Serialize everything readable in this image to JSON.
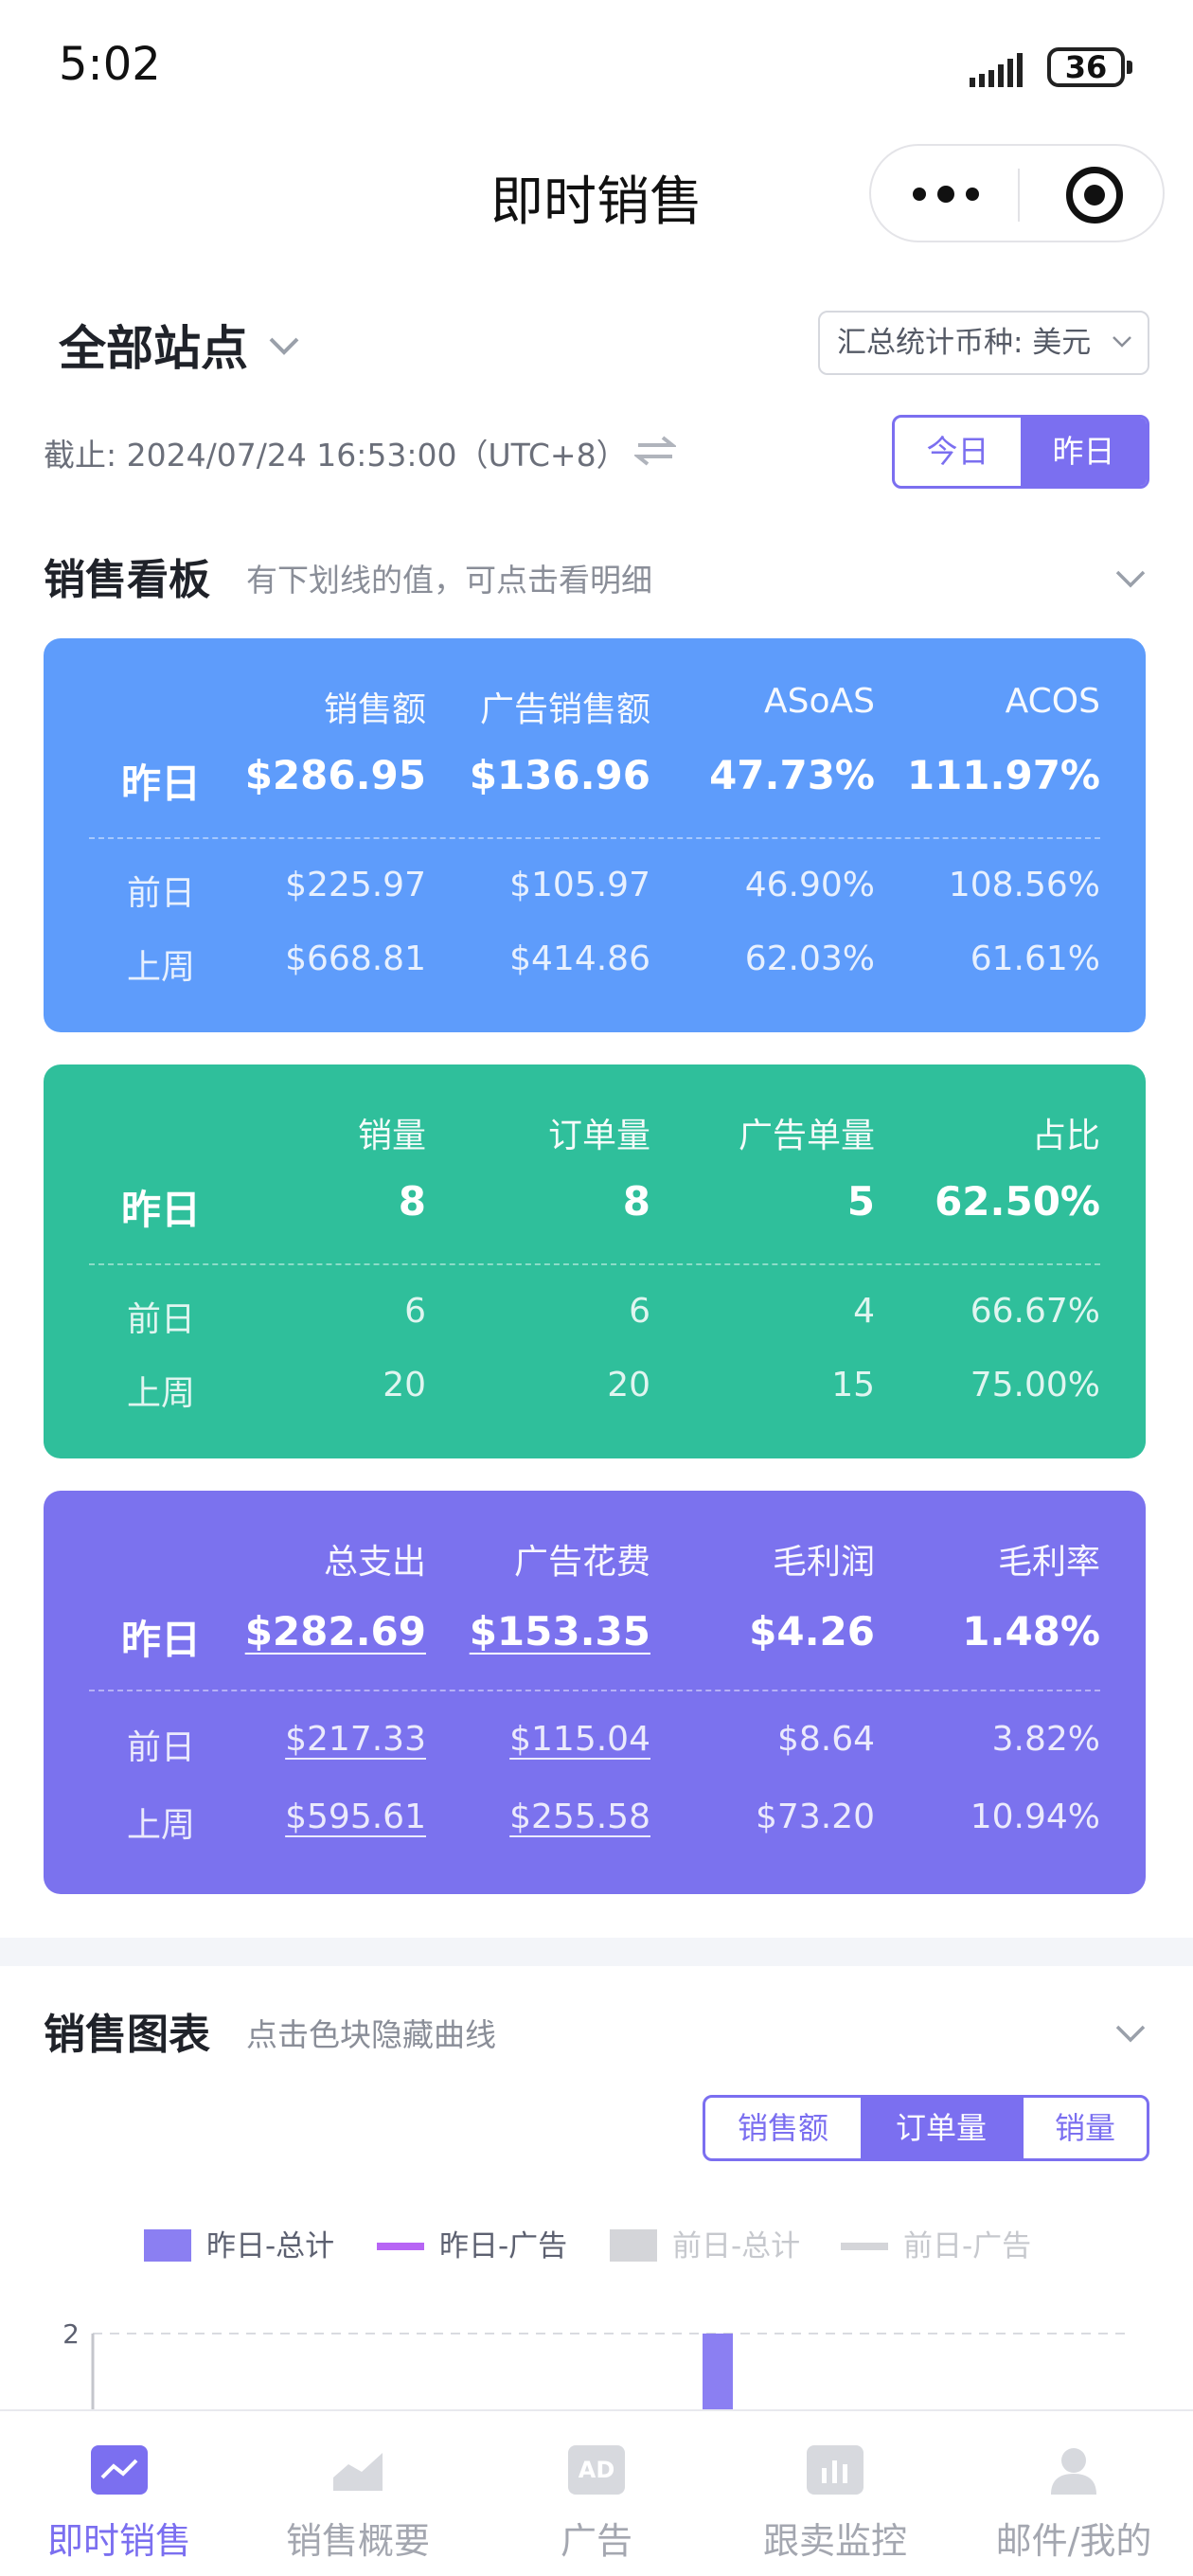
{
  "status_bar": {
    "time": "5:02",
    "battery": "36"
  },
  "nav": {
    "title": "即时销售"
  },
  "filters": {
    "station": "全部站点",
    "currency_label": "汇总统计币种: 美元",
    "deadline": "截止: 2024/07/24 16:53:00（UTC+8）",
    "day_toggle": [
      "今日",
      "昨日"
    ],
    "day_active": "昨日"
  },
  "sales_board": {
    "title": "销售看板",
    "subtitle": "有下划线的值，可点击看明细",
    "row_labels": [
      "昨日",
      "前日",
      "上周"
    ],
    "cards": [
      {
        "headers": [
          "销售额",
          "广告销售额",
          "ASoAS",
          "ACOS"
        ],
        "rows": [
          [
            "$286.95",
            "$136.96",
            "47.73%",
            "111.97%"
          ],
          [
            "$225.97",
            "$105.97",
            "46.90%",
            "108.56%"
          ],
          [
            "$668.81",
            "$414.86",
            "62.03%",
            "61.61%"
          ]
        ]
      },
      {
        "headers": [
          "销量",
          "订单量",
          "广告单量",
          "占比"
        ],
        "rows": [
          [
            "8",
            "8",
            "5",
            "62.50%"
          ],
          [
            "6",
            "6",
            "4",
            "66.67%"
          ],
          [
            "20",
            "20",
            "15",
            "75.00%"
          ]
        ]
      },
      {
        "headers": [
          "总支出",
          "广告花费",
          "毛利润",
          "毛利率"
        ],
        "rows": [
          [
            "$282.69",
            "$153.35",
            "$4.26",
            "1.48%"
          ],
          [
            "$217.33",
            "$115.04",
            "$8.64",
            "3.82%"
          ],
          [
            "$595.61",
            "$255.58",
            "$73.20",
            "10.94%"
          ]
        ]
      }
    ]
  },
  "sales_chart": {
    "title": "销售图表",
    "subtitle": "点击色块隐藏曲线",
    "tabs": [
      "销售额",
      "订单量",
      "销量"
    ],
    "tab_active": "订单量",
    "legend": [
      {
        "label": "昨日-总计",
        "color": "#8b7ff2",
        "active": true,
        "kind": "box"
      },
      {
        "label": "昨日-广告",
        "color": "#b765f5",
        "active": true,
        "kind": "line"
      },
      {
        "label": "前日-总计",
        "color": "#d4d5d9",
        "active": false,
        "kind": "box"
      },
      {
        "label": "前日-广告",
        "color": "#d4d5d9",
        "active": false,
        "kind": "line"
      }
    ],
    "y_tick_top": "2"
  },
  "chart_data": {
    "type": "bar",
    "y_ticks": [
      "2"
    ],
    "series": [
      {
        "name": "昨日-总计",
        "values": [
          2
        ]
      }
    ]
  },
  "tabbar": {
    "items": [
      "即时销售",
      "销售概要",
      "广告",
      "跟卖监控",
      "邮件/我的"
    ],
    "active": "即时销售",
    "ad_icon_text": "AD"
  }
}
